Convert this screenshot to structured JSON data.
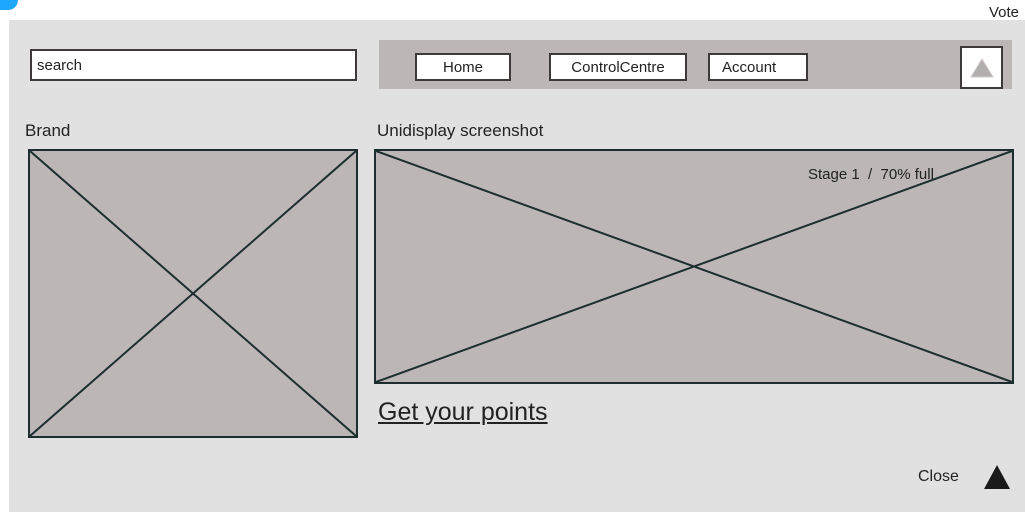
{
  "header": {
    "vote_label": "Vote"
  },
  "search": {
    "placeholder": "search"
  },
  "nav": {
    "items": [
      {
        "label": "Home"
      },
      {
        "label": "ControlCentre"
      },
      {
        "label": "Account"
      }
    ],
    "up_icon": "triangle-up-icon"
  },
  "brand": {
    "label": "Brand"
  },
  "screenshot": {
    "label": "Unidisplay screenshot",
    "stage_text": "Stage 1  /  70% full"
  },
  "points_link": "Get your points",
  "close_label": "Close",
  "colors": {
    "panel": "#e1e1e1",
    "placeholder_fill": "#bcb6b6",
    "border": "#3e3a3a",
    "corner_badge": "#1ea7ff"
  }
}
